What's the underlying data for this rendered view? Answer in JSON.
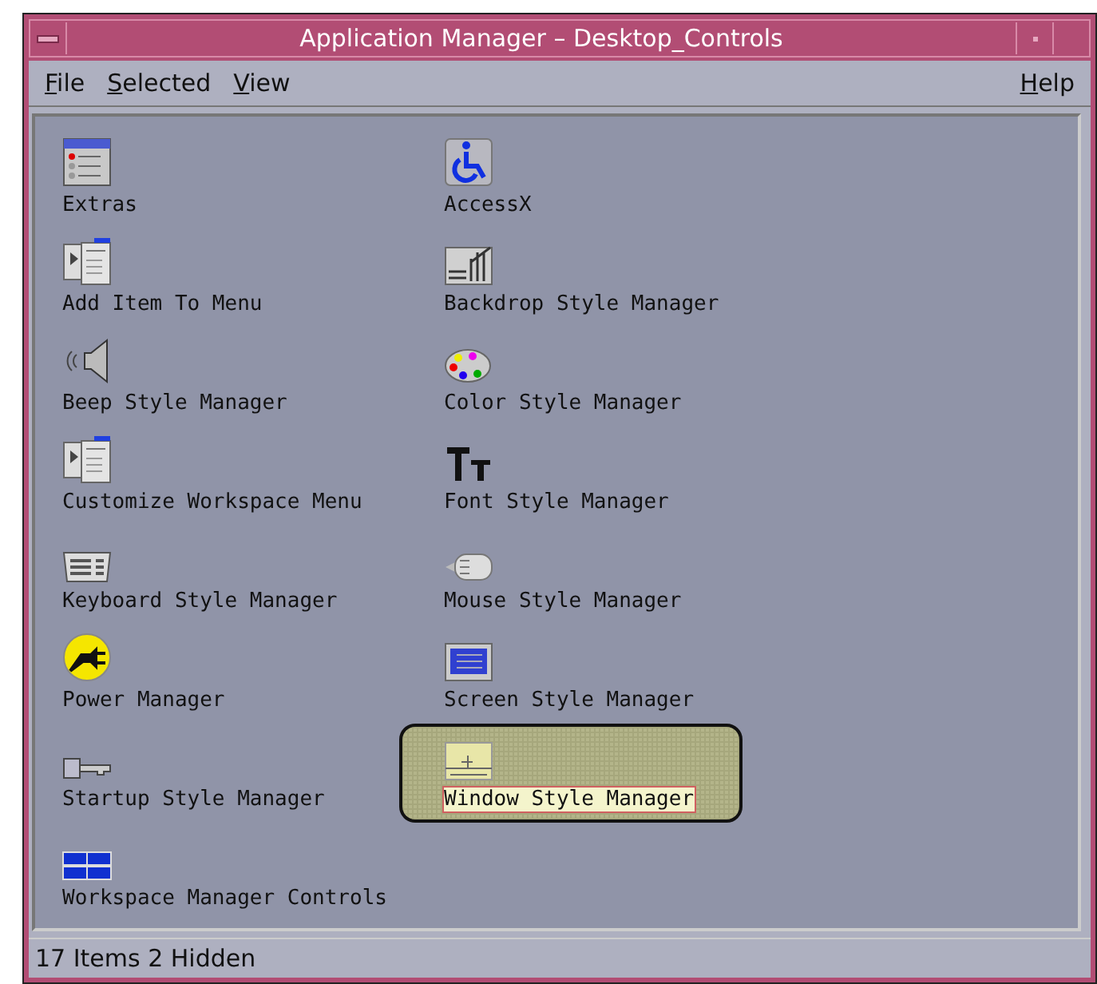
{
  "window": {
    "title": "Application Manager – Desktop_Controls"
  },
  "menu": [
    {
      "label": "File"
    },
    {
      "label": "Selected"
    },
    {
      "label": "View"
    },
    {
      "label": "Help"
    }
  ],
  "items": [
    {
      "label": "Extras",
      "kind": "folder",
      "selected": false
    },
    {
      "label": "AccessX",
      "kind": "wheelchair",
      "selected": false
    },
    {
      "label": "Add Item To Menu",
      "kind": "menu",
      "selected": false
    },
    {
      "label": "Backdrop Style Manager",
      "kind": "backdrop",
      "selected": false
    },
    {
      "label": "Beep Style Manager",
      "kind": "speaker",
      "selected": false
    },
    {
      "label": "Color Style Manager",
      "kind": "palette",
      "selected": false
    },
    {
      "label": "Customize Workspace Menu",
      "kind": "menu",
      "selected": false
    },
    {
      "label": "Font Style Manager",
      "kind": "font",
      "selected": false
    },
    {
      "label": "Keyboard Style Manager",
      "kind": "keyboard",
      "selected": false
    },
    {
      "label": "Mouse Style Manager",
      "kind": "mouse",
      "selected": false
    },
    {
      "label": "Power Manager",
      "kind": "plug",
      "selected": false
    },
    {
      "label": "Screen Style Manager",
      "kind": "screen",
      "selected": false
    },
    {
      "label": "Startup Style Manager",
      "kind": "key",
      "selected": false
    },
    {
      "label": "Window Style Manager",
      "kind": "window",
      "selected": true
    },
    {
      "label": "Workspace Manager Controls",
      "kind": "workspaces",
      "selected": false
    }
  ],
  "status_bar": {
    "text": "17 Items 2 Hidden"
  }
}
